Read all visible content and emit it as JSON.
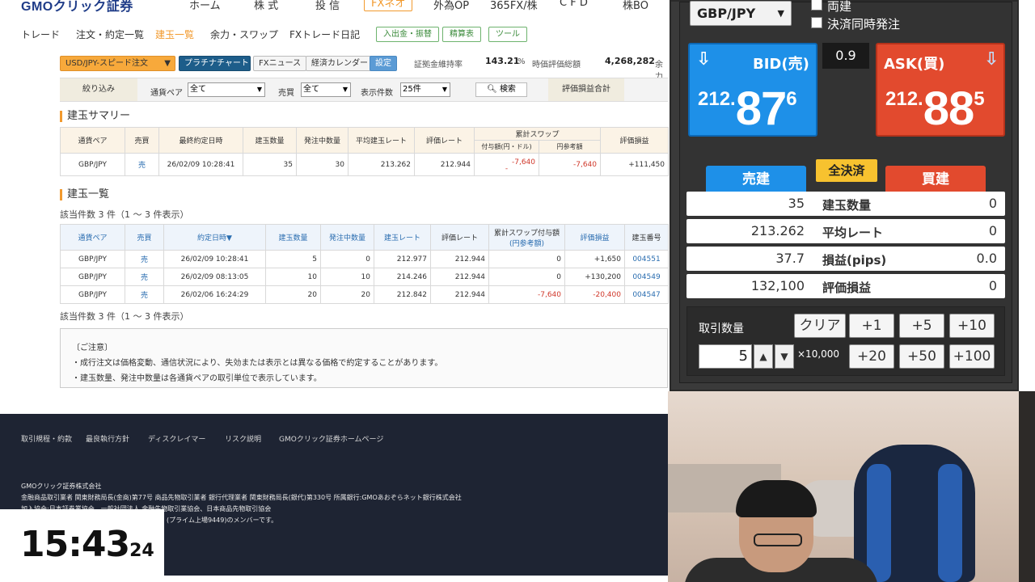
{
  "topnav": {
    "logo": "GMOクリック証券",
    "items": [
      "ホーム",
      "株 式",
      "投 信",
      "FXネオ",
      "外為OP",
      "365FX/株",
      "C F D",
      "株BO"
    ]
  },
  "subnav": {
    "items": [
      "トレード",
      "注文・約定一覧",
      "建玉一覧",
      "余力・スワップ",
      "FXトレード日記"
    ],
    "pills": [
      "入出金・振替",
      "精算表",
      "ツール"
    ]
  },
  "toolbar": {
    "order_button": "USD/JPY-スピード注文",
    "chart_button": "プラチナチャート",
    "news_button": "FXニュース",
    "calendar_button": "経済カレンダー",
    "settings_button": "設定",
    "margin_label": "証拠金維持率",
    "margin_value": "143.21",
    "margin_unit": "%",
    "valuation_label": "時価評価総額",
    "valuation_value": "4,268,282",
    "surplus_label": "余力"
  },
  "filter": {
    "narrow_button": "絞り込み",
    "pair_label": "通貨ペア",
    "pair_value": "全て",
    "side_label": "売買",
    "side_value": "全て",
    "count_label": "表示件数",
    "count_value": "25件",
    "search_button": "検索",
    "total_button": "評価損益合計"
  },
  "summary": {
    "title": "建玉サマリー",
    "headers": [
      "通貨ペア",
      "売買",
      "最終約定日時",
      "建玉数量",
      "発注中数量",
      "平均建玉レート",
      "評価レート",
      "累計スワップ",
      "付与額(円・ドル)",
      "円参考額",
      "評価損益"
    ],
    "row": [
      "GBP/JPY",
      "売",
      "26/02/09 10:28:41",
      "35",
      "30",
      "213.262",
      "212.944",
      "-7,640",
      "-",
      "-7,640",
      "+111,450"
    ]
  },
  "positions": {
    "title": "建玉一覧",
    "count_note": "該当件数 3 件（1 ～ 3 件表示）",
    "headers": [
      "通貨ペア",
      "売買",
      "約定日時▼",
      "建玉数量",
      "発注中数量",
      "建玉レート",
      "評価レート",
      "累計スワップ付与額",
      "(円参考額)",
      "評価損益",
      "建玉番号"
    ],
    "rows": [
      [
        "GBP/JPY",
        "売",
        "26/02/09 10:28:41",
        "5",
        "0",
        "212.977",
        "212.944",
        "0",
        "+1,650",
        "004551"
      ],
      [
        "GBP/JPY",
        "売",
        "26/02/09 08:13:05",
        "10",
        "10",
        "214.246",
        "212.944",
        "0",
        "+130,200",
        "004549"
      ],
      [
        "GBP/JPY",
        "売",
        "26/02/06 16:24:29",
        "20",
        "20",
        "212.842",
        "212.944",
        "-7,640",
        "-20,400",
        "004547"
      ]
    ],
    "count_note_bottom": "該当件数 3 件（1 ～ 3 件表示）"
  },
  "notice": {
    "heading": "〔ご注意〕",
    "lines": [
      "成行注文は価格変動、通信状況により、失効または表示とは異なる価格で約定することがあります。",
      "建玉数量、発注中数量は各通貨ペアの取引単位で表示しています。"
    ]
  },
  "footer": {
    "links": [
      "取引規程・約款",
      "最良執行方針",
      "ディスクレイマー",
      "リスク説明",
      "GMOクリック証券ホームページ"
    ],
    "company": "GMOクリック証券株式会社",
    "lines": [
      "金融商品取引業者 関東財務局長(金商)第77号 商品先物取引業者 銀行代理業者 関東財務局長(銀代)第330号 所属銀行:GMOあおぞらネット銀行株式会社",
      "加入協会:日本証券業協会、一般社団法人 金融先物取引業協会、日本商品先物取引協会",
      "(プライム上場9449)のメンバーです。"
    ]
  },
  "clock": {
    "hm": "15:43",
    "sec": "24"
  },
  "panel": {
    "pair": "GBP/JPY",
    "check1": "両建",
    "check2": "決済同時発注",
    "bid": {
      "title": "BID(売)",
      "p1": "212.",
      "p2": "87",
      "p3": "6"
    },
    "ask": {
      "title": "ASK(買)",
      "p1": "212.",
      "p2": "88",
      "p3": "5"
    },
    "spread": "0.9",
    "tab_sell": "売建",
    "tab_buy": "買建",
    "close_all": "全決済",
    "stats": [
      {
        "sell": "35",
        "label": "建玉数量",
        "buy": "0"
      },
      {
        "sell": "213.262",
        "label": "平均レート",
        "buy": "0"
      },
      {
        "sell": "37.7",
        "label": "損益(pips)",
        "buy": "0.0"
      },
      {
        "sell": "132,100",
        "label": "評価損益",
        "buy": "0"
      }
    ],
    "qty_label": "取引数量",
    "qty_value": "5",
    "unit": "×10,000",
    "clear": "クリア",
    "btns": [
      "+1",
      "+5",
      "+10",
      "+20",
      "+50",
      "+100"
    ]
  },
  "colors": {
    "brand_orange": "#f29a2e",
    "bid_blue": "#1e90e8",
    "ask_red": "#e24a2e",
    "negative": "#d0382b"
  }
}
